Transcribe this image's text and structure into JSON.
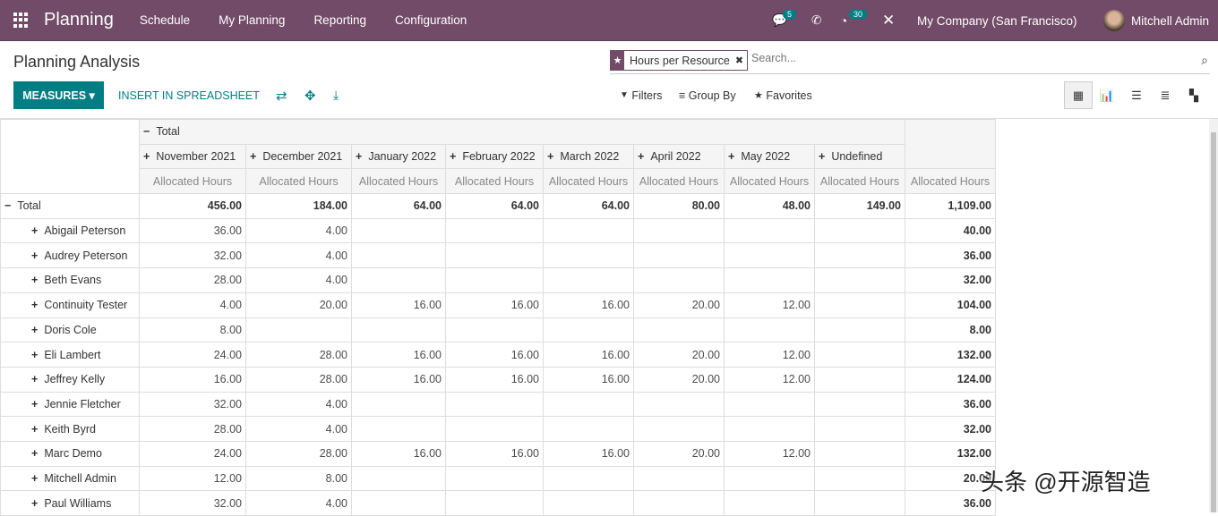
{
  "nav": {
    "app": "Planning",
    "menus": [
      "Schedule",
      "My Planning",
      "Reporting",
      "Configuration"
    ],
    "messages_count": "5",
    "activities_count": "30",
    "company": "My Company (San Francisco)",
    "user": "Mitchell Admin"
  },
  "control": {
    "title": "Planning Analysis",
    "measures": "MEASURES",
    "insert": "INSERT IN SPREADSHEET",
    "facet": "Hours per Resource",
    "search_placeholder": "Search...",
    "filters": "Filters",
    "group_by": "Group By",
    "favorites": "Favorites"
  },
  "pivot": {
    "col_total": "Total",
    "measure": "Allocated Hours",
    "row_total": "Total",
    "columns": [
      "November 2021",
      "December 2021",
      "January 2022",
      "February 2022",
      "March 2022",
      "April 2022",
      "May 2022",
      "Undefined"
    ],
    "totals": [
      "456.00",
      "184.00",
      "64.00",
      "64.00",
      "64.00",
      "80.00",
      "48.00",
      "149.00",
      "1,109.00"
    ],
    "rows": [
      {
        "name": "Abigail Peterson",
        "values": [
          "36.00",
          "4.00",
          "",
          "",
          "",
          "",
          "",
          "",
          "40.00"
        ]
      },
      {
        "name": "Audrey Peterson",
        "values": [
          "32.00",
          "4.00",
          "",
          "",
          "",
          "",
          "",
          "",
          "36.00"
        ]
      },
      {
        "name": "Beth Evans",
        "values": [
          "28.00",
          "4.00",
          "",
          "",
          "",
          "",
          "",
          "",
          "32.00"
        ]
      },
      {
        "name": "Continuity Tester",
        "values": [
          "4.00",
          "20.00",
          "16.00",
          "16.00",
          "16.00",
          "20.00",
          "12.00",
          "",
          "104.00"
        ]
      },
      {
        "name": "Doris Cole",
        "values": [
          "8.00",
          "",
          "",
          "",
          "",
          "",
          "",
          "",
          "8.00"
        ]
      },
      {
        "name": "Eli Lambert",
        "values": [
          "24.00",
          "28.00",
          "16.00",
          "16.00",
          "16.00",
          "20.00",
          "12.00",
          "",
          "132.00"
        ]
      },
      {
        "name": "Jeffrey Kelly",
        "values": [
          "16.00",
          "28.00",
          "16.00",
          "16.00",
          "16.00",
          "20.00",
          "12.00",
          "",
          "124.00"
        ]
      },
      {
        "name": "Jennie Fletcher",
        "values": [
          "32.00",
          "4.00",
          "",
          "",
          "",
          "",
          "",
          "",
          "36.00"
        ]
      },
      {
        "name": "Keith Byrd",
        "values": [
          "28.00",
          "4.00",
          "",
          "",
          "",
          "",
          "",
          "",
          "32.00"
        ]
      },
      {
        "name": "Marc Demo",
        "values": [
          "24.00",
          "28.00",
          "16.00",
          "16.00",
          "16.00",
          "20.00",
          "12.00",
          "",
          "132.00"
        ]
      },
      {
        "name": "Mitchell Admin",
        "values": [
          "12.00",
          "8.00",
          "",
          "",
          "",
          "",
          "",
          "",
          "20.00"
        ]
      },
      {
        "name": "Paul Williams",
        "values": [
          "32.00",
          "4.00",
          "",
          "",
          "",
          "",
          "",
          "",
          "36.00"
        ]
      }
    ]
  },
  "watermark": "头条 @开源智造"
}
